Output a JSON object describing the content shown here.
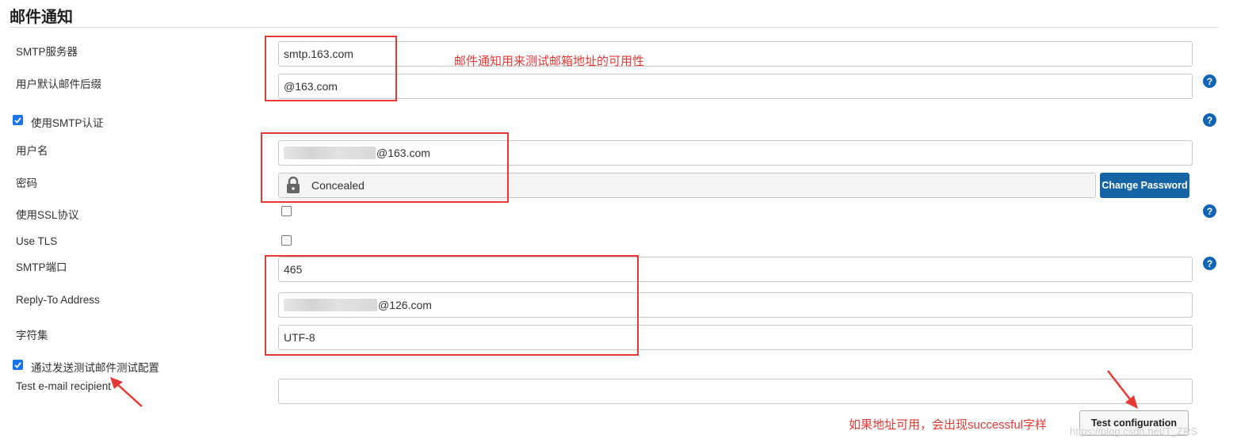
{
  "section": {
    "title": "邮件通知"
  },
  "fields": {
    "smtp_server": {
      "label": "SMTP服务器",
      "value": "smtp.163.com"
    },
    "default_suffix": {
      "label": "用户默认邮件后缀",
      "value": "@163.com"
    },
    "use_smtp_auth": {
      "label": "使用SMTP认证",
      "checked": true
    },
    "username": {
      "label": "用户名",
      "value": "@163.com"
    },
    "password": {
      "label": "密码",
      "value": "Concealed",
      "button": "Change Password"
    },
    "use_ssl": {
      "label": "使用SSL协议",
      "checked": false
    },
    "use_tls": {
      "label": "Use TLS",
      "checked": false
    },
    "smtp_port": {
      "label": "SMTP端口",
      "value": "465"
    },
    "reply_to": {
      "label": "Reply-To Address",
      "value": "@126.com"
    },
    "charset": {
      "label": "字符集",
      "value": "UTF-8"
    },
    "test_mail": {
      "label": "通过发送测试邮件测试配置",
      "checked": true
    },
    "test_recipient": {
      "label": "Test e-mail recipient",
      "value": ""
    }
  },
  "buttons": {
    "test_configuration": "Test configuration"
  },
  "annotations": {
    "top_note": "邮件通知用来测试邮箱地址的可用性",
    "bottom_note": "如果地址可用，会出现successful字样"
  },
  "watermark": "https://blog.csdn.net/T_ZRS",
  "colors": {
    "annotation_red": "#e53935",
    "primary_button": "#1565a6",
    "help_icon": "#1265b5"
  }
}
